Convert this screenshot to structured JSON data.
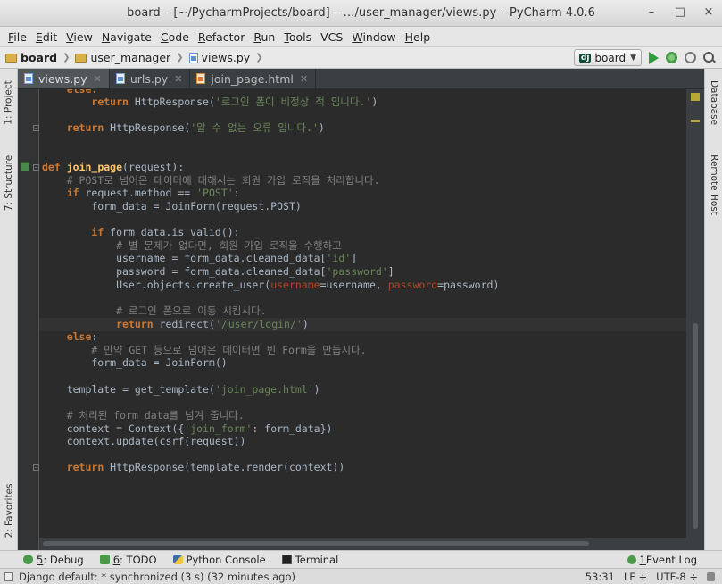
{
  "window": {
    "title": "board – [~/PycharmProjects/board] – …/user_manager/views.py – PyCharm 4.0.6",
    "controls": [
      "–",
      "□",
      "×"
    ]
  },
  "menu": [
    {
      "u": "F",
      "rest": "ile"
    },
    {
      "u": "E",
      "rest": "dit"
    },
    {
      "u": "V",
      "rest": "iew"
    },
    {
      "u": "N",
      "rest": "avigate"
    },
    {
      "u": "C",
      "rest": "ode"
    },
    {
      "u": "R",
      "rest": "efactor"
    },
    {
      "u": "R",
      "rest": "un",
      "pre": ""
    },
    {
      "u": "T",
      "rest": "ools"
    },
    {
      "u": "",
      "rest": "VCS",
      "pre": "VC"
    },
    {
      "u": "W",
      "rest": "indow"
    },
    {
      "u": "H",
      "rest": "elp"
    }
  ],
  "menu_labels": [
    "File",
    "Edit",
    "View",
    "Navigate",
    "Code",
    "Refactor",
    "Run",
    "Tools",
    "VCS",
    "Window",
    "Help"
  ],
  "breadcrumbs": [
    "board",
    "user_manager",
    "views.py"
  ],
  "run_config": {
    "badge": "dj",
    "label": "board"
  },
  "tabs": [
    {
      "label": "views.py",
      "active": true,
      "type": "py"
    },
    {
      "label": "urls.py",
      "active": false,
      "type": "py"
    },
    {
      "label": "join_page.html",
      "active": false,
      "type": "html"
    }
  ],
  "left_tool_tabs": [
    "1: Project",
    "7: Structure",
    "2: Favorites"
  ],
  "right_tool_tabs": [
    "Database",
    "Remote Host"
  ],
  "code_lines": [
    "    else:",
    "        return HttpResponse('로그인 폼이 비정상 적 입니다.')",
    "",
    "    return HttpResponse('알 수 없는 오류 입니다.')",
    "",
    "",
    "def join_page(request):",
    "    # POST로 넘어온 데이터에 대해서는 회원 가입 로직을 처리합니다.",
    "    if request.method == 'POST':",
    "        form_data = JoinForm(request.POST)",
    "",
    "        if form_data.is_valid():",
    "            # 별 문제가 없다면, 회원 가입 로직을 수행하고",
    "            username = form_data.cleaned_data['id']",
    "            password = form_data.cleaned_data['password']",
    "            User.objects.create_user(username=username, password=password)",
    "",
    "            # 로그인 폼으로 이동 시킵시다.",
    "            return redirect('/user/login/')",
    "    else:",
    "        # 만약 GET 등으로 넘어온 데이터면 빈 Form을 만듭시다.",
    "        form_data = JoinForm()",
    "",
    "    template = get_template('join_page.html')",
    "",
    "    # 처리된 form_data를 넘겨 줍니다.",
    "    context = Context({'join_form': form_data})",
    "    context.update(csrf(request))",
    "",
    "    return HttpResponse(template.render(context))"
  ],
  "bottom_tools": [
    {
      "num": "5",
      "label": ": Debug",
      "icon": "debug"
    },
    {
      "num": "6",
      "label": ": TODO",
      "icon": "todo"
    },
    {
      "num": "",
      "label": "Python Console",
      "icon": "python"
    },
    {
      "num": "",
      "label": "Terminal",
      "icon": "terminal"
    }
  ],
  "event_log": {
    "num": "1",
    "label": " Event Log"
  },
  "status": {
    "message": "Django default: * synchronized (3 s) (32 minutes ago)",
    "position": "53:31",
    "line_sep": "LF ÷",
    "encoding": "UTF-8 ÷"
  }
}
